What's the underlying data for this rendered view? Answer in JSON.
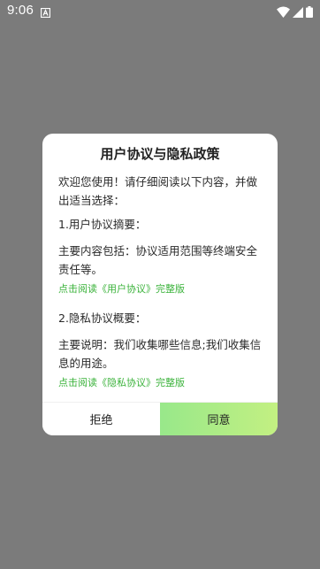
{
  "status_bar": {
    "time": "9:06"
  },
  "dialog": {
    "title": "用户协议与隐私政策",
    "intro": "欢迎您使用！请仔细阅读以下内容，并做出适当选择：",
    "section1_heading": "1.用户协议摘要：",
    "section1_text": "主要内容包括：协议适用范围等终端安全责任等。",
    "section1_link": "点击阅读《用户协议》完整版",
    "section2_heading": "2.隐私协议概要：",
    "section2_text": "主要说明：我们收集哪些信息;我们收集信息的用途。",
    "section2_link": "点击阅读《隐私协议》完整版",
    "refuse_label": "拒绝",
    "agree_label": "同意"
  },
  "colors": {
    "overlay": "#7b7b7b",
    "link": "#3cb33c",
    "agree_start": "#98e88a",
    "agree_end": "#c3f082"
  },
  "icons": {
    "notification": "notification-a-icon",
    "wifi": "wifi-icon",
    "signal": "cell-signal-icon",
    "battery": "battery-icon"
  }
}
